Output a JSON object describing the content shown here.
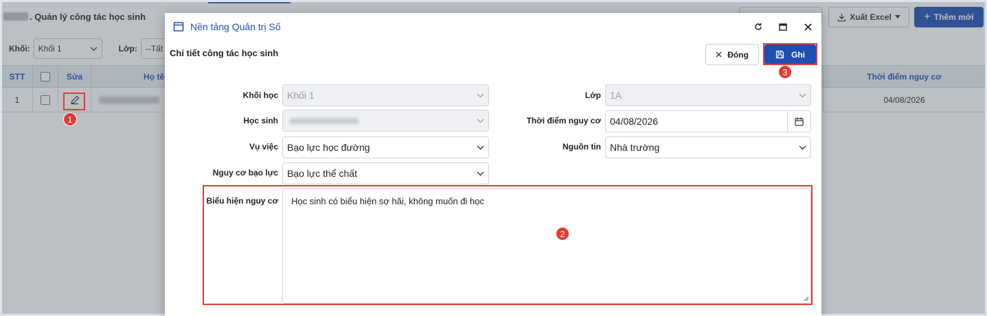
{
  "background": {
    "page_title": ". Quản lý công tác học sinh",
    "toolbar": {
      "export_label": "Xuất Excel",
      "add_label": "Thêm mới"
    },
    "filters": {
      "grade_label": "Khối:",
      "grade_value": "Khối 1",
      "class_label": "Lớp:",
      "class_value": "--Tất"
    },
    "table": {
      "headers": [
        "STT",
        "",
        "Sửa",
        "Họ tê",
        "Thời điểm nguy cơ"
      ],
      "rows": [
        {
          "stt": "1",
          "date": "04/08/2026"
        }
      ]
    }
  },
  "dialog": {
    "window_title": "Nền tảng Quản trị Số",
    "subtitle": "Chi tiết công tác học sinh",
    "close_label": "Đóng",
    "save_label": "Ghi",
    "fields": {
      "grade_label": "Khối học",
      "grade_value": "Khối 1",
      "class_label": "Lớp",
      "class_value": "1A",
      "student_label": "Học sinh",
      "risk_time_label": "Thời điểm nguy cơ",
      "risk_time_value": "04/08/2026",
      "incident_label": "Vụ việc",
      "incident_value": "Bạo lực học đường",
      "source_label": "Nguồn tin",
      "source_value": "Nhà trường",
      "violence_risk_label": "Nguy cơ bạo lực",
      "violence_risk_value": "Bạo lực thể chất",
      "sign_label": "Biểu hiện nguy cơ",
      "sign_value": "Học sinh có biểu hiện sợ hãi, không muốn đi học"
    }
  },
  "markers": [
    "1",
    "2",
    "3"
  ],
  "colors": {
    "primary": "#1e4fb3",
    "highlight": "#e53935"
  }
}
